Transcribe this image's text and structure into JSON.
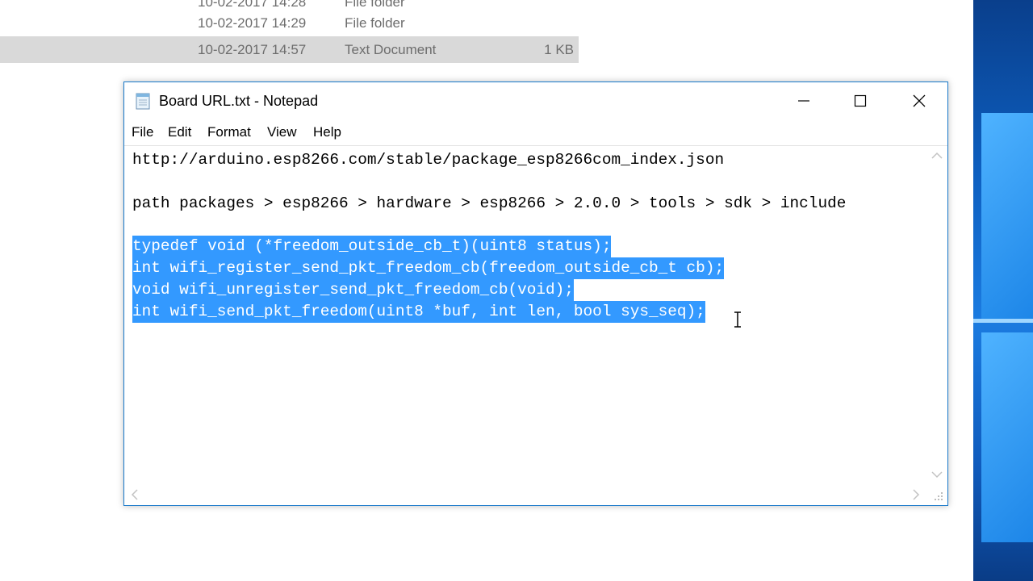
{
  "explorer": {
    "rows": [
      {
        "date": "10-02-2017 14:28",
        "type": "File folder",
        "size": ""
      },
      {
        "date": "10-02-2017 14:29",
        "type": "File folder",
        "size": ""
      },
      {
        "date": "10-02-2017 14:57",
        "type": "Text Document",
        "size": "1 KB",
        "selected": true
      }
    ]
  },
  "notepad": {
    "title": "Board URL.txt - Notepad",
    "menu": [
      "File",
      "Edit",
      "Format",
      "View",
      "Help"
    ],
    "lines": [
      {
        "text": "http://arduino.esp8266.com/stable/package_esp8266com_index.json",
        "selected": false
      },
      {
        "text": "",
        "selected": false
      },
      {
        "text": "path packages > esp8266 > hardware > esp8266 > 2.0.0 > tools > sdk > include",
        "selected": false
      },
      {
        "text": "",
        "selected": false
      },
      {
        "text": "typedef void (*freedom_outside_cb_t)(uint8 status);",
        "selected": true
      },
      {
        "text": "int wifi_register_send_pkt_freedom_cb(freedom_outside_cb_t cb);",
        "selected": true
      },
      {
        "text": "void wifi_unregister_send_pkt_freedom_cb(void);",
        "selected": true
      },
      {
        "text": "int wifi_send_pkt_freedom(uint8 *buf, int len, bool sys_seq);",
        "selected": true
      }
    ]
  },
  "icons": {
    "app": "notepad-icon",
    "minimize": "minimize-icon",
    "maximize": "maximize-icon",
    "close": "close-icon"
  },
  "colors": {
    "selection": "#3399ff",
    "window_border": "#1979ca",
    "explorer_selected_row": "#d9d9d9"
  }
}
